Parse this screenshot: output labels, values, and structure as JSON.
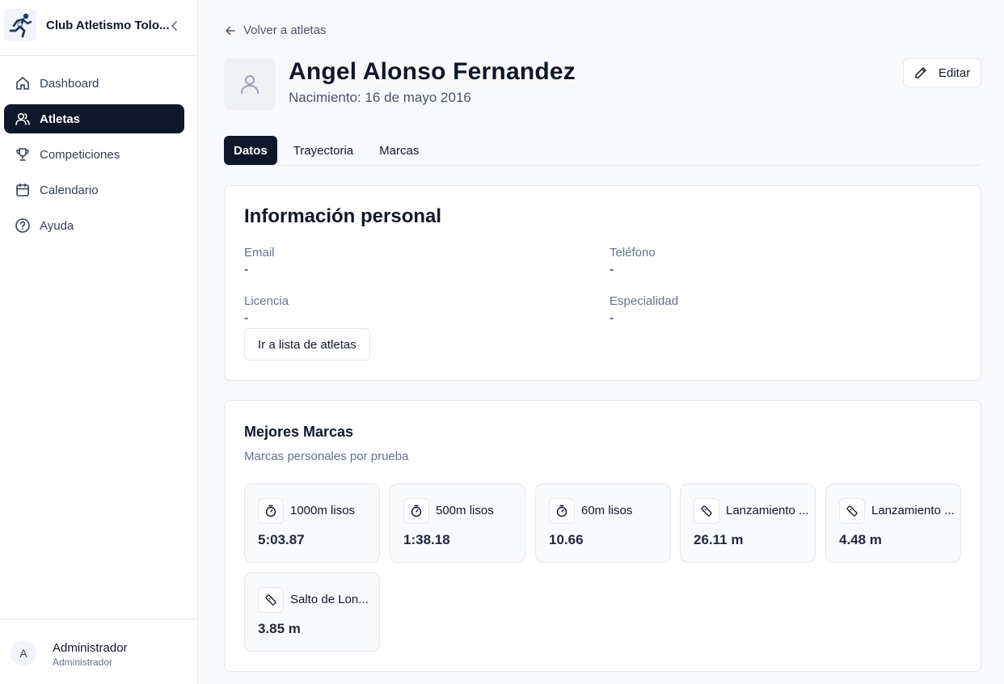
{
  "sidebar": {
    "club_name": "Club Atletismo Tolo...",
    "logo_icon": "runner-logo-icon",
    "nav": [
      {
        "label": "Dashboard",
        "icon": "home-icon",
        "active": false
      },
      {
        "label": "Atletas",
        "icon": "users-icon",
        "active": true
      },
      {
        "label": "Competiciones",
        "icon": "trophy-icon",
        "active": false
      },
      {
        "label": "Calendario",
        "icon": "calendar-icon",
        "active": false
      },
      {
        "label": "Ayuda",
        "icon": "help-circle-icon",
        "active": false
      }
    ],
    "user": {
      "initial": "A",
      "name": "Administrador",
      "role": "Administrador"
    }
  },
  "main": {
    "back_label": "Volver a atletas",
    "athlete_name": "Angel Alonso Fernandez",
    "birth": "Nacimiento: 16 de mayo 2016",
    "edit_label": "Editar",
    "tabs": [
      {
        "label": "Datos",
        "active": true
      },
      {
        "label": "Trayectoria",
        "active": false
      },
      {
        "label": "Marcas",
        "active": false
      }
    ],
    "personal": {
      "title": "Información personal",
      "fields": [
        {
          "label": "Email",
          "value": "-"
        },
        {
          "label": "Teléfono",
          "value": "-"
        },
        {
          "label": "Licencia",
          "value": "-"
        },
        {
          "label": "Especialidad",
          "value": "-"
        }
      ],
      "button_label": "Ir a lista de atletas"
    },
    "best_marks": {
      "title": "Mejores Marcas",
      "subtitle": "Marcas personales por prueba",
      "items": [
        {
          "name": "1000m lisos",
          "value": "5:03.87",
          "icon": "timer-icon"
        },
        {
          "name": "500m lisos",
          "value": "1:38.18",
          "icon": "timer-icon"
        },
        {
          "name": "60m lisos",
          "value": "10.66",
          "icon": "timer-icon"
        },
        {
          "name": "Lanzamiento ...",
          "value": "26.11 m",
          "icon": "ruler-icon"
        },
        {
          "name": "Lanzamiento ...",
          "value": "4.48 m",
          "icon": "ruler-icon"
        },
        {
          "name": "Salto de Lon...",
          "value": "3.85 m",
          "icon": "ruler-icon"
        }
      ]
    }
  },
  "colors": {
    "primary": "#0f172a",
    "muted": "#64748b",
    "border": "#e2e8f0",
    "background": "#f8f9fb"
  }
}
